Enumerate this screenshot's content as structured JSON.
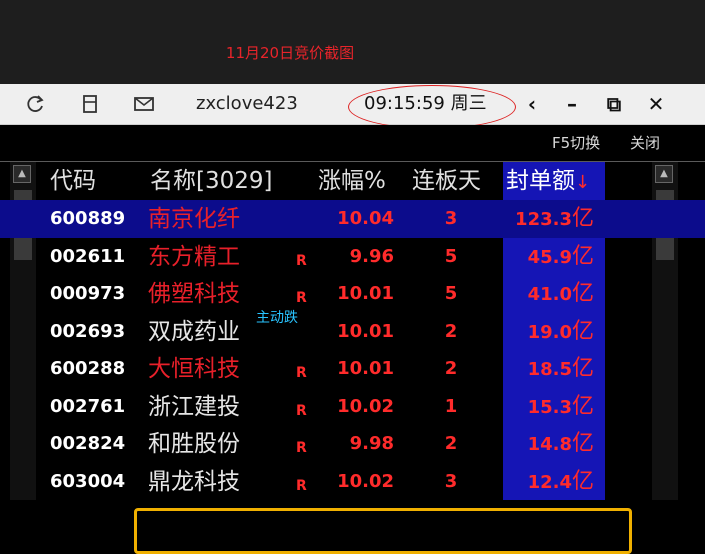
{
  "caption": "11月20日竞价截图",
  "titlebar": {
    "icons": [
      "refresh-icon",
      "clipboard-icon",
      "mail-icon"
    ],
    "username": "zxclove423",
    "time": "09:15:59 周三",
    "buttons": [
      "‹",
      "–",
      "⧉",
      "✕"
    ]
  },
  "toolbar": {
    "switch_label": "F5切换",
    "close_label": "关闭"
  },
  "table": {
    "headers": {
      "code": "代码",
      "name": "名称[3029]",
      "pct": "涨幅%",
      "days": "连板天",
      "amount": "封单额"
    },
    "sort_arrow": "↓",
    "selected_row": 0,
    "rows": [
      {
        "code": "600889",
        "name": "南京化纤",
        "name_color": "#e8202a",
        "flag": "",
        "pct": "10.04",
        "days": "3",
        "amount": "123.3",
        "unit": "亿",
        "tag": ""
      },
      {
        "code": "002611",
        "name": "东方精工",
        "name_color": "#e8202a",
        "flag": "R",
        "pct": "9.96",
        "days": "5",
        "amount": "45.9",
        "unit": "亿",
        "tag": ""
      },
      {
        "code": "000973",
        "name": "佛塑科技",
        "name_color": "#e8202a",
        "flag": "R",
        "pct": "10.01",
        "days": "5",
        "amount": "41.0",
        "unit": "亿",
        "tag": ""
      },
      {
        "code": "002693",
        "name": "双成药业",
        "name_color": "#e6e6e6",
        "flag": "",
        "pct": "10.01",
        "days": "2",
        "amount": "19.0",
        "unit": "亿",
        "tag": "主动跌"
      },
      {
        "code": "600288",
        "name": "大恒科技",
        "name_color": "#e8202a",
        "flag": "R",
        "pct": "10.01",
        "days": "2",
        "amount": "18.5",
        "unit": "亿",
        "tag": ""
      },
      {
        "code": "002761",
        "name": "浙江建投",
        "name_color": "#e6e6e6",
        "flag": "R",
        "pct": "10.02",
        "days": "1",
        "amount": "15.3",
        "unit": "亿",
        "tag": ""
      },
      {
        "code": "002824",
        "name": "和胜股份",
        "name_color": "#e6e6e6",
        "flag": "R",
        "pct": "9.98",
        "days": "2",
        "amount": "14.8",
        "unit": "亿",
        "tag": ""
      },
      {
        "code": "603004",
        "name": "鼎龙科技",
        "name_color": "#e6e6e6",
        "flag": "R",
        "pct": "10.02",
        "days": "3",
        "amount": "12.4",
        "unit": "亿",
        "tag": ""
      }
    ]
  },
  "colors": {
    "accent_red": "#ff2b2b",
    "seal_column": "#1515b5",
    "selected_row": "#0c0c8c",
    "highlight_box": "#f0b000",
    "tag": "#29c4ff"
  }
}
